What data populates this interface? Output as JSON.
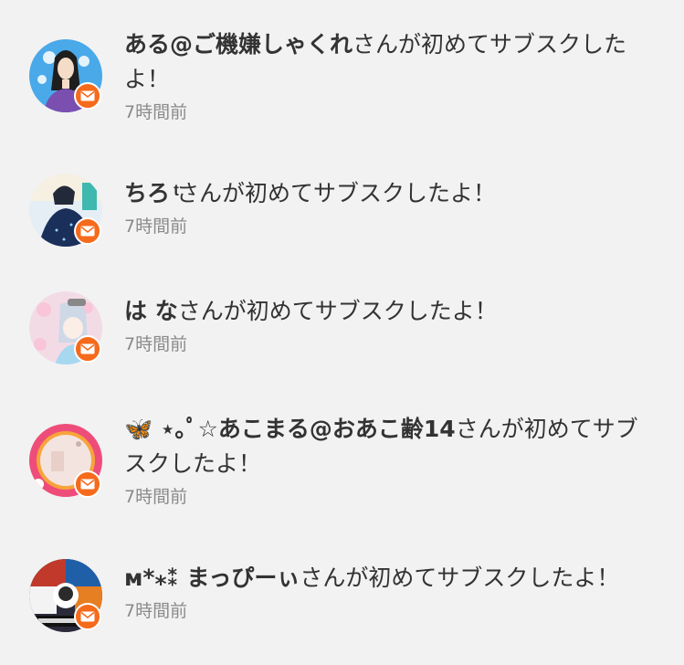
{
  "notifications": [
    {
      "name": "ある@ご機嫌しゃくれ",
      "message": "さんが初めてサブスクしたよ！",
      "time": "7時間前",
      "avatar_icon": "avatar-woman-icon"
    },
    {
      "name": "ちろ ͭ",
      "message": "さんが初めてサブスクしたよ！",
      "time": "7時間前",
      "avatar_icon": "avatar-night-dress-icon"
    },
    {
      "name": "は な",
      "message": "さんが初めてサブスクしたよ！",
      "time": "7時間前",
      "avatar_icon": "avatar-anime-girl-icon"
    },
    {
      "name": "🦋 ⋆｡ﾟ☆あこまる@おあこ齢14",
      "message": "さんが初めてサブスクしたよ！",
      "time": "7時間前",
      "avatar_icon": "avatar-pink-frame-icon"
    },
    {
      "name": "ᴍ*⁎⁑ まっぴーぃ",
      "message": "さんが初めてサブスクしたよ！",
      "time": "7時間前",
      "avatar_icon": "avatar-collage-icon"
    }
  ],
  "badge_icon": "mail-icon",
  "colors": {
    "background": "#f2f2f2",
    "badge": "#f56a1b",
    "text": "#333333",
    "time": "#8a8a8a"
  }
}
